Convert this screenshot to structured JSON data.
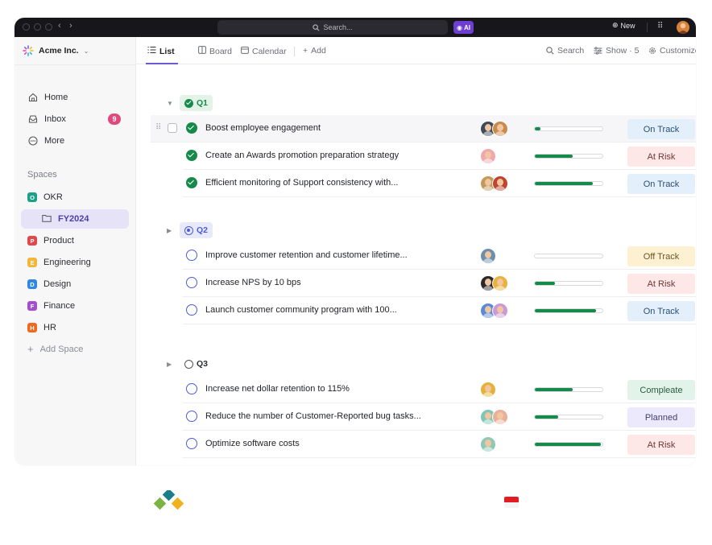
{
  "titlebar": {
    "search_placeholder": "Search...",
    "ai_label": "AI",
    "new_label": "New"
  },
  "sidebar": {
    "workspace": "Acme Inc.",
    "items": [
      {
        "label": "Home",
        "icon": "home-icon"
      },
      {
        "label": "Inbox",
        "icon": "inbox-icon",
        "count": "9"
      },
      {
        "label": "More",
        "icon": "more-icon"
      }
    ],
    "spaces_heading": "Spaces",
    "spaces": [
      {
        "letter": "O",
        "label": "OKR",
        "color": "#1aa188"
      },
      {
        "letter": "P",
        "label": "Product",
        "color": "#e0484b"
      },
      {
        "letter": "E",
        "label": "Engineering",
        "color": "#f2b63a"
      },
      {
        "letter": "D",
        "label": "Design",
        "color": "#2f87e3"
      },
      {
        "letter": "F",
        "label": "Finance",
        "color": "#a34fc9"
      },
      {
        "letter": "H",
        "label": "HR",
        "color": "#ef6a1e"
      }
    ],
    "folder": "FY2024",
    "add_space": "Add Space"
  },
  "toolbar": {
    "views": [
      "List",
      "Board",
      "Calendar"
    ],
    "add": "Add",
    "search": "Search",
    "show": "Show · 5",
    "customize": "Customize"
  },
  "groups": [
    {
      "name": "Q1",
      "state": "done",
      "color": "#168a4a",
      "bg": "#e3f3e8",
      "rows": [
        {
          "title": "Boost employee engagement",
          "status": "On Track",
          "progress": 0.06,
          "avatars": [
            "#3e4b59",
            "#c98a4a"
          ]
        },
        {
          "title": "Create an Awards promotion preparation strategy",
          "status": "At Risk",
          "progress": 0.56,
          "avatars": [
            "#f0a7b0"
          ]
        },
        {
          "title": "Efficient monitoring of Support consistency with...",
          "status": "On Track",
          "progress": 0.86,
          "avatars": [
            "#c49a5a",
            "#c0452e"
          ]
        }
      ]
    },
    {
      "name": "Q2",
      "state": "open",
      "color": "#4b5bd6",
      "bg": "#e8eafb",
      "rows": [
        {
          "title": "Improve customer retention and customer lifetime...",
          "status": "Off Track",
          "progress": 0.0,
          "avatars": [
            "#6d8fae"
          ]
        },
        {
          "title": "Increase NPS by 10 bps",
          "status": "At Risk",
          "progress": 0.3,
          "avatars": [
            "#2a2a2a",
            "#e9b23c"
          ]
        },
        {
          "title": "Launch customer community program with 100...",
          "status": "On Track",
          "progress": 0.9,
          "avatars": [
            "#5b8ad8",
            "#c99ad6"
          ]
        }
      ]
    },
    {
      "name": "Q3",
      "state": "empty",
      "color": "#8a8d95",
      "bg": "#ffffff",
      "rows": [
        {
          "title": "Increase net dollar retention to 115%",
          "status": "Compleate",
          "progress": 0.56,
          "avatars": [
            "#e6b13a"
          ]
        },
        {
          "title": "Reduce the number of Customer-Reported bug tasks...",
          "status": "Planned",
          "progress": 0.35,
          "avatars": [
            "#7fc6b4",
            "#e8b09a"
          ]
        },
        {
          "title": "Optimize software costs",
          "status": "At Risk",
          "progress": 0.98,
          "avatars": [
            "#8fc9b6"
          ]
        }
      ]
    }
  ],
  "status_styles": {
    "On Track": {
      "bg": "#e3f0fb",
      "fg": "#2b4f72"
    },
    "At Risk": {
      "bg": "#fde7e7",
      "fg": "#6e3737"
    },
    "Off Track": {
      "bg": "#fdf1d2",
      "fg": "#6b5424"
    },
    "Compleate": {
      "bg": "#e2f3ea",
      "fg": "#2c5a40"
    },
    "Planned": {
      "bg": "#ebe9fb",
      "fg": "#423c70"
    }
  }
}
